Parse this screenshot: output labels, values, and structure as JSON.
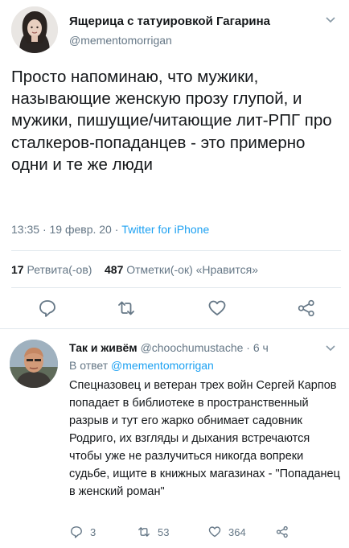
{
  "tweet": {
    "author_name": "Ящерица с татуировкой Гагарина",
    "author_handle": "@mementomorrigan",
    "text": "Просто напоминаю, что мужики, называющие женскую прозу глупой, и мужики, пишущие/читающие лит-РПГ про сталкеров-попаданцев - это примерно одни и те же люди",
    "time": "13:35",
    "date": "19 февр. 20",
    "source": "Twitter for iPhone",
    "retweets_count": "17",
    "retweets_label": "Ретвита(-ов)",
    "likes_count": "487",
    "likes_label": "Отметки(-ок) «Нравится»"
  },
  "reply": {
    "author_name": "Так и живём",
    "author_handle": "@choochumustache",
    "age": "6 ч",
    "reply_to_label": "В ответ",
    "reply_to_handle": "@mementomorrigan",
    "text": "Спецназовец и ветеран трех войн Сергей Карпов попадает в библиотеке в пространственный разрыв и тут его жарко обнимает садовник Родриго, их взгляды и дыхания встречаются чтобы уже не разлучиться никогда вопреки судьбе, ищите в книжных магазинах - \"Попаданец в женский роман\"",
    "reply_count": "3",
    "retweet_count": "53",
    "like_count": "364"
  },
  "colors": {
    "text": "#14171a",
    "secondary": "#657786",
    "link": "#1da1f2",
    "divider": "#e1e8ed"
  }
}
